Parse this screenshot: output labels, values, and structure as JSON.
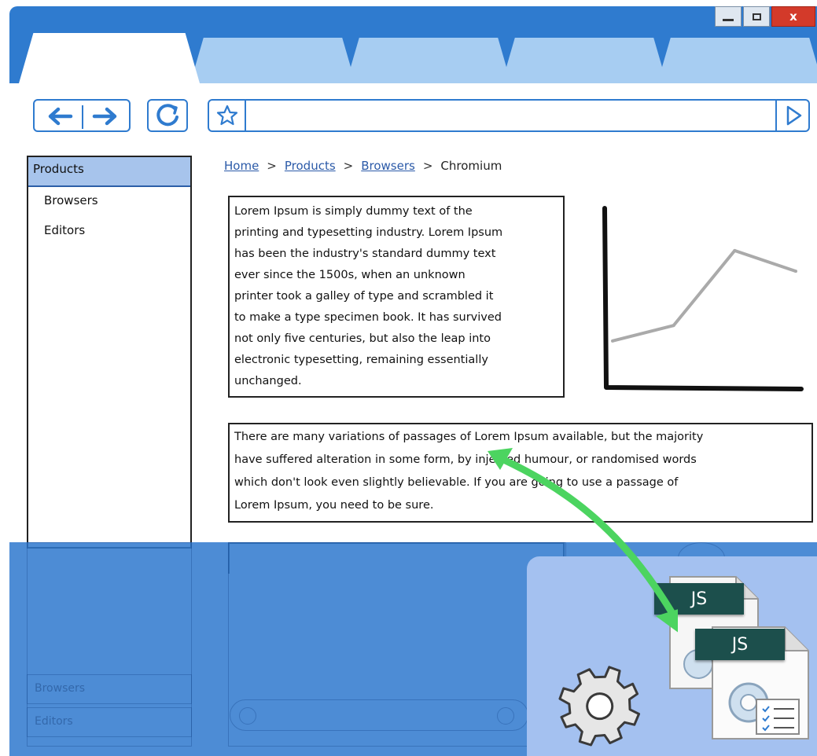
{
  "window": {
    "close_label": "x"
  },
  "sidebar": {
    "selected": "Products",
    "items": [
      "Browsers",
      "Editors"
    ]
  },
  "breadcrumb": {
    "items": [
      "Home",
      "Products",
      "Browsers"
    ],
    "current": "Chromium"
  },
  "content": {
    "paragraph1_lines": [
      "Lorem Ipsum is simply dummy text of the",
      "printing and typesetting industry. Lorem Ipsum",
      "has been the industry's standard dummy text",
      "ever since the 1500s, when an unknown",
      "printer took a galley of type and scrambled it",
      "to make a type specimen book. It has survived",
      "not only five centuries, but also the leap into",
      "electronic typesetting, remaining essentially",
      "unchanged."
    ],
    "paragraph2_lines": [
      "There are many variations of passages of Lorem Ipsum available, but the majority",
      "have suffered alteration in some form, by injected humour, or randomised words",
      "which don't look even slightly believable. If you are going to use a passage of",
      "Lorem Ipsum, you need to be sure."
    ]
  },
  "chart_data": {
    "type": "line",
    "x": [
      0,
      1,
      2,
      3
    ],
    "series": [
      {
        "values": [
          1.8,
          2.4,
          5.3,
          4.5
        ]
      }
    ],
    "xlabel": "",
    "ylabel": "",
    "ylim": [
      0,
      7
    ],
    "grid": false,
    "line_color": "#aaaaaa"
  },
  "ghost_sidebar": {
    "items": [
      "Browsers",
      "Editors"
    ]
  },
  "badges": {
    "js_back": "JS",
    "js_front": "JS"
  },
  "colors": {
    "chrome_blue": "#2f7bcf",
    "tab_inactive": "#a7cdf2",
    "sidebar_selected": "#a7c4ec",
    "arrow_green": "#4cd460",
    "badge_bg": "#1c4f4c"
  }
}
